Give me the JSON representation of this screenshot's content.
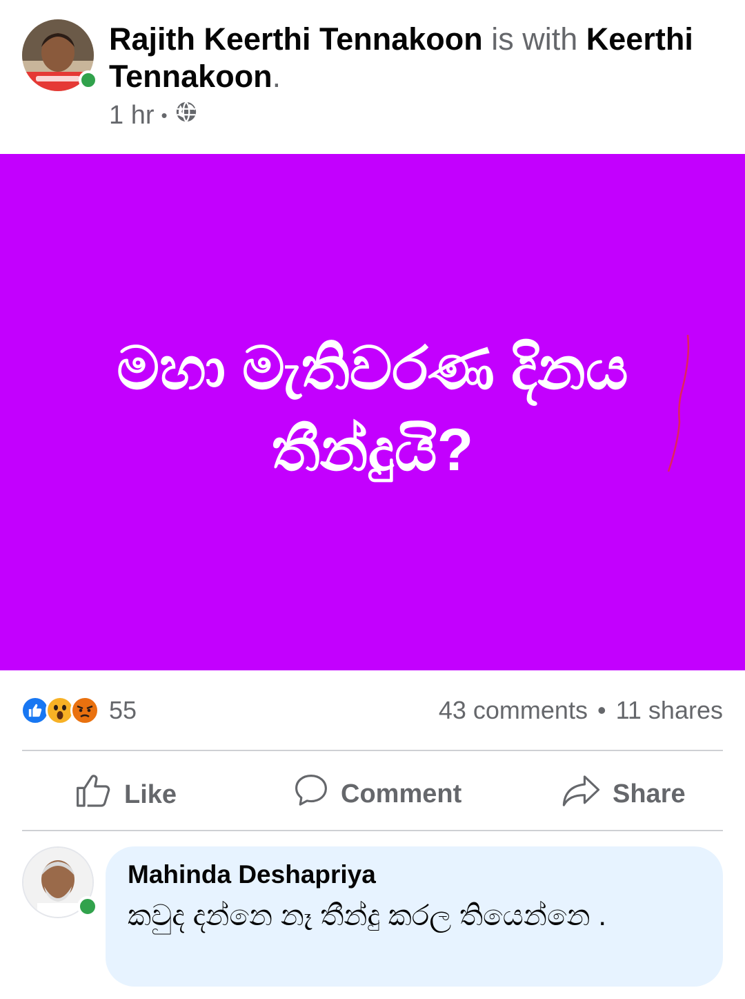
{
  "post": {
    "author": "Rajith Keerthi Tennakoon",
    "with_text": "is with",
    "tagged": "Keerthi Tennakoon",
    "period": ".",
    "time": "1 hr",
    "separator": "•",
    "privacy_icon": "globe-icon",
    "image_bg": "#c300fe",
    "image_text_line1": "මහා මැතිවරණ දිනය",
    "image_text_line2": "තීන්දුයි?"
  },
  "stats": {
    "reaction_icons": [
      "like-icon",
      "wow-icon",
      "angry-icon"
    ],
    "reaction_count": "55",
    "comments": "43 comments",
    "dot": "•",
    "shares": "11 shares"
  },
  "actions": {
    "like": "Like",
    "comment": "Comment",
    "share": "Share"
  },
  "comment": {
    "author": "Mahinda Deshapriya",
    "text": "කවුද දන්නෙ නෑ තීන්දු කරල තියෙන්නෙ ."
  },
  "colors": {
    "online": "#31a24c",
    "like_blue": "#1877f2",
    "muted": "#65676b",
    "bubble": "#e7f3ff"
  }
}
